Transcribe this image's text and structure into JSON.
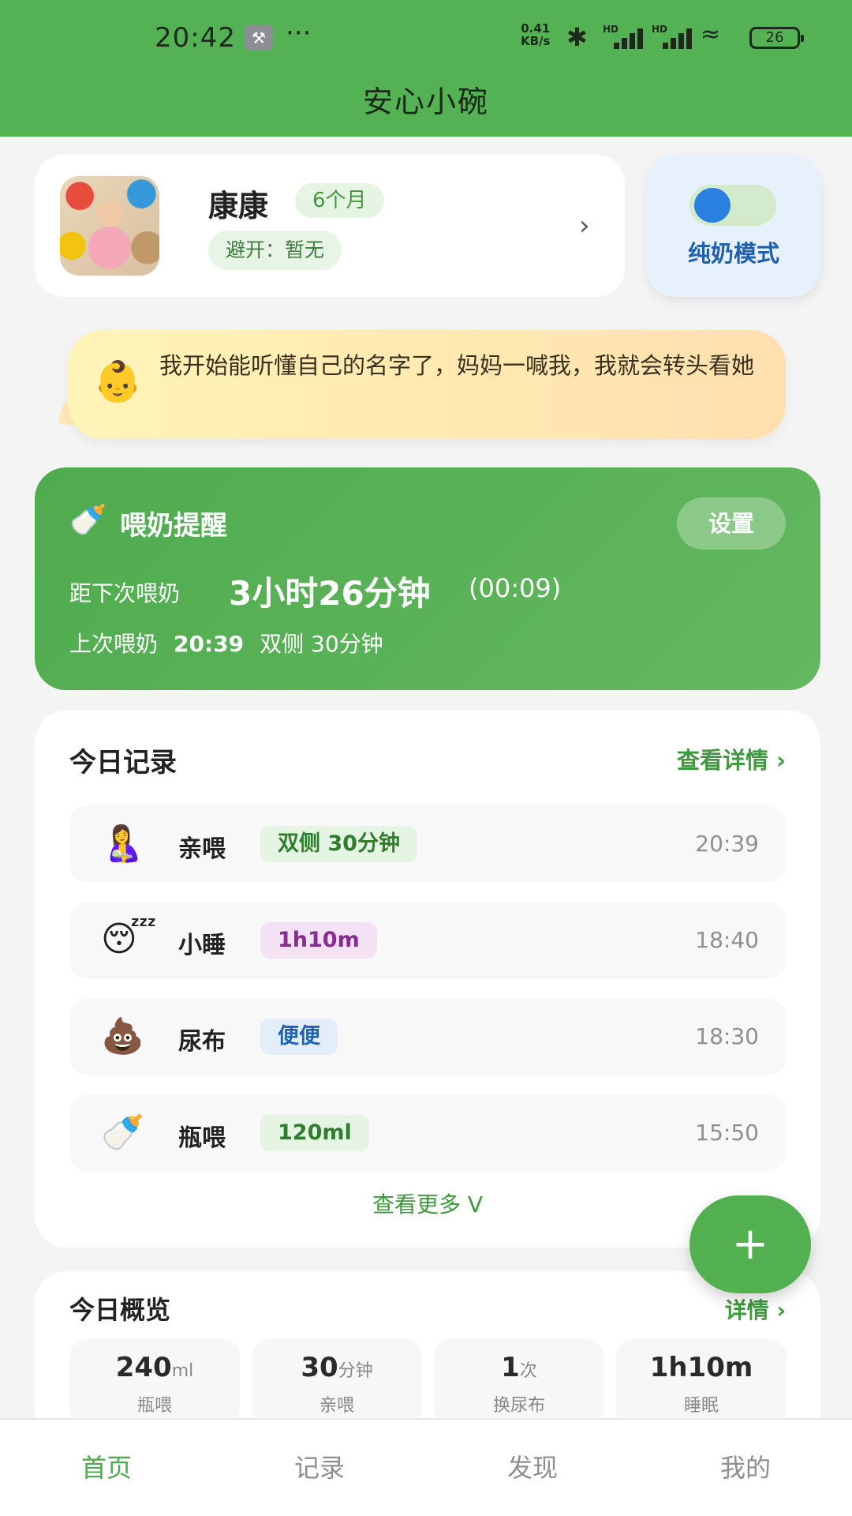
{
  "status_bar": {
    "time": "20:42",
    "dots": "···",
    "net_speed_top": "0.41",
    "net_speed_bottom": "KB/s",
    "bluetooth_icon": "bluetooth-icon",
    "sig1_label": "HD",
    "sig2_label": "HD",
    "battery": "26"
  },
  "app": {
    "title": "安心小碗"
  },
  "baby": {
    "name": "康康",
    "age": "6个月",
    "avoid": "避开：暂无"
  },
  "mode": {
    "label": "纯奶模式",
    "enabled": true
  },
  "tip": {
    "text": "我开始能听懂自己的名字了，妈妈一喊我，我就会转头看她"
  },
  "feeding": {
    "title": "喂奶提醒",
    "settings_label": "设置",
    "next_label": "距下次喂奶",
    "next_value": "3小时26分钟",
    "next_time": "(00:09)",
    "last_label": "上次喂奶",
    "last_time": "20:39",
    "last_detail": "双侧 30分钟"
  },
  "records": {
    "title": "今日记录",
    "link": "查看详情 ›",
    "more": "查看更多 V",
    "items": [
      {
        "emoji": "🤱",
        "name": "亲喂",
        "tag": "双侧 30分钟",
        "time": "20:39",
        "tag_bg": "#e6f4e3",
        "tag_color": "#2f7d2d"
      },
      {
        "emoji": "😴",
        "name": "小睡",
        "tag": "1h10m",
        "time": "18:40",
        "tag_bg": "#f3e2f4",
        "tag_color": "#8a2a93"
      },
      {
        "emoji": "💩",
        "name": "尿布",
        "tag": "便便",
        "time": "18:30",
        "tag_bg": "#e3eefa",
        "tag_color": "#1f63b8"
      },
      {
        "emoji": "🍼",
        "name": "瓶喂",
        "tag": "120ml",
        "time": "15:50",
        "tag_bg": "#e6f4e3",
        "tag_color": "#2f7d2d"
      }
    ]
  },
  "fab": {
    "label": "+"
  },
  "overview": {
    "title": "今日概览",
    "link": "详情 ›",
    "items": [
      {
        "value": "240",
        "unit": "ml",
        "label": "瓶喂"
      },
      {
        "value": "30",
        "unit": "分钟",
        "label": "亲喂"
      },
      {
        "value": "1",
        "unit": "次",
        "label": "换尿布"
      },
      {
        "value": "1h10m",
        "unit": "",
        "label": "睡眠"
      }
    ]
  },
  "nav": {
    "items": [
      "首页",
      "记录",
      "发现",
      "我的"
    ],
    "active": 0
  },
  "colors": {
    "primary": "#55b254",
    "accent_blue": "#2a80de"
  }
}
